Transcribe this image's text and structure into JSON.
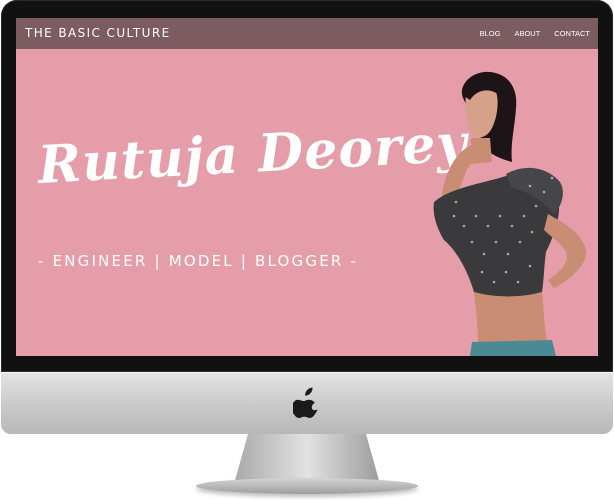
{
  "site": {
    "logo": "THE BASIC CULTURE",
    "nav": [
      "BLOG",
      "ABOUT",
      "CONTACT"
    ]
  },
  "hero": {
    "name": "Rutuja Deorey",
    "tagline": "- ENGINEER | MODEL | BLOGGER -"
  },
  "colors": {
    "header_bg": "#7c5b61",
    "hero_bg": "#e59ea9",
    "text": "#ffffff"
  },
  "icons": {
    "chin_logo": "apple-logo-icon"
  }
}
